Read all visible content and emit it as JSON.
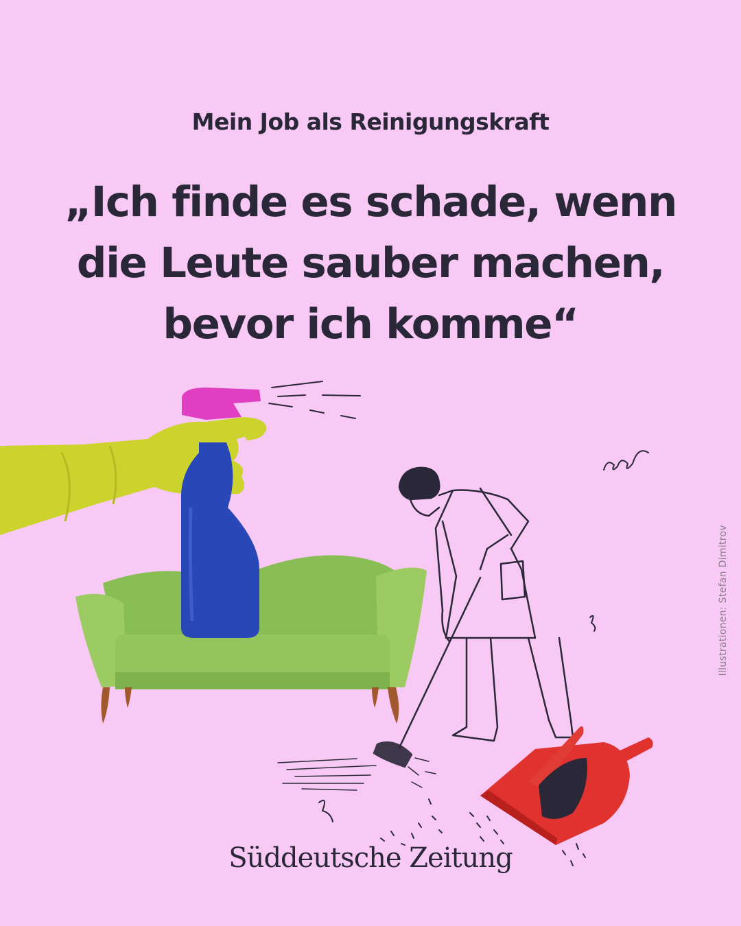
{
  "header": {
    "kicker": "Mein Job als Reinigungskraft",
    "headline_lines": [
      "„Ich finde es schade, wenn",
      "die Leute sauber machen,",
      "bevor ich komme“"
    ]
  },
  "credit": "Illustrationen: Stefan Dimitrov",
  "brand": "Süddeutsche Zeitung",
  "colors": {
    "background": "#f8c9f4",
    "text": "#2a2838",
    "glove": "#cbd32c",
    "bottle": "#2848b8",
    "trigger": "#e13fc2",
    "sofa": "#8fc25a",
    "dustpan": "#e0322e"
  },
  "icons": [
    "rubber-glove-icon",
    "spray-bottle-icon",
    "sofa-icon",
    "cleaner-person-icon",
    "dustpan-brush-icon"
  ]
}
